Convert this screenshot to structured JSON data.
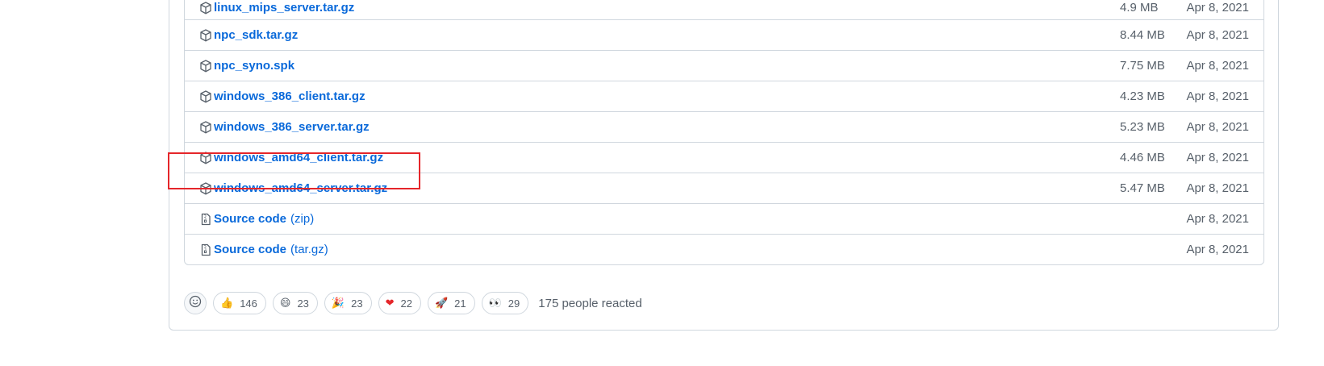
{
  "assets": [
    {
      "name": "linux_mips_server.tar.gz",
      "suffix": "",
      "size": "4.9 MB",
      "date": "Apr 8, 2021",
      "icon": "package-icon"
    },
    {
      "name": "npc_sdk.tar.gz",
      "suffix": "",
      "size": "8.44 MB",
      "date": "Apr 8, 2021",
      "icon": "package-icon"
    },
    {
      "name": "npc_syno.spk",
      "suffix": "",
      "size": "7.75 MB",
      "date": "Apr 8, 2021",
      "icon": "package-icon"
    },
    {
      "name": "windows_386_client.tar.gz",
      "suffix": "",
      "size": "4.23 MB",
      "date": "Apr 8, 2021",
      "icon": "package-icon"
    },
    {
      "name": "windows_386_server.tar.gz",
      "suffix": "",
      "size": "5.23 MB",
      "date": "Apr 8, 2021",
      "icon": "package-icon"
    },
    {
      "name": "windows_amd64_client.tar.gz",
      "suffix": "",
      "size": "4.46 MB",
      "date": "Apr 8, 2021",
      "icon": "package-icon"
    },
    {
      "name": "windows_amd64_server.tar.gz",
      "suffix": "",
      "size": "5.47 MB",
      "date": "Apr 8, 2021",
      "icon": "package-icon"
    },
    {
      "name": "Source code",
      "suffix": "(zip)",
      "size": "",
      "date": "Apr 8, 2021",
      "icon": "file-zip-icon"
    },
    {
      "name": "Source code",
      "suffix": "(tar.gz)",
      "size": "",
      "date": "Apr 8, 2021",
      "icon": "file-zip-icon"
    }
  ],
  "reactions": {
    "items": [
      {
        "emoji": "👍",
        "name": "thumbs-up",
        "count": "146"
      },
      {
        "emoji": "😄",
        "name": "laugh",
        "count": "23"
      },
      {
        "emoji": "🎉",
        "name": "hooray",
        "count": "23"
      },
      {
        "emoji": "❤",
        "name": "heart",
        "count": "22"
      },
      {
        "emoji": "🚀",
        "name": "rocket",
        "count": "21"
      },
      {
        "emoji": "👀",
        "name": "eyes",
        "count": "29"
      }
    ],
    "summary": "175 people reacted"
  },
  "colors": {
    "link": "#0969da",
    "muted": "#57606a",
    "border": "#d0d7de",
    "highlight": "#e5262a"
  }
}
